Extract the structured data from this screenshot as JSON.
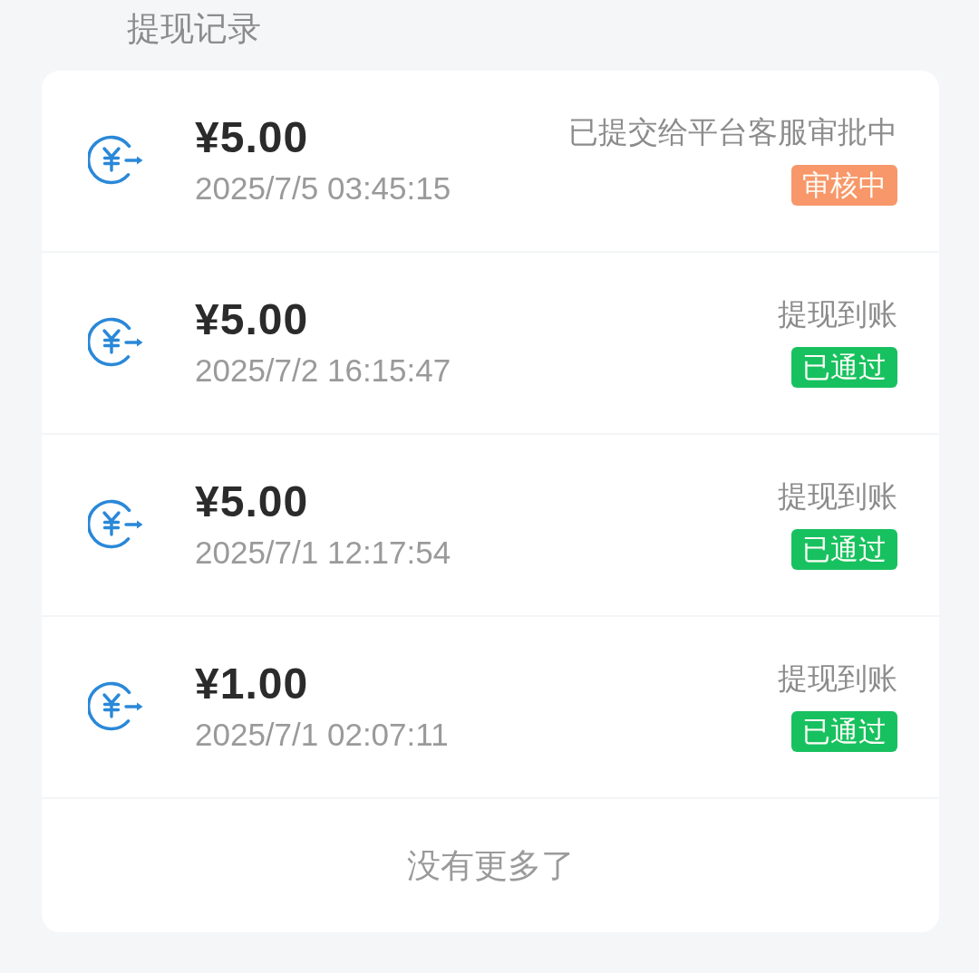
{
  "page": {
    "title": "提现记录"
  },
  "records": [
    {
      "amount": "¥5.00",
      "time": "2025/7/5 03:45:15",
      "note": "已提交给平台客服审批中",
      "badge": {
        "label": "审核中",
        "color": "#f7976a"
      }
    },
    {
      "amount": "¥5.00",
      "time": "2025/7/2 16:15:47",
      "note": "提现到账",
      "badge": {
        "label": "已通过",
        "color": "#18c160"
      }
    },
    {
      "amount": "¥5.00",
      "time": "2025/7/1 12:17:54",
      "note": "提现到账",
      "badge": {
        "label": "已通过",
        "color": "#18c160"
      }
    },
    {
      "amount": "¥1.00",
      "time": "2025/7/1 02:07:11",
      "note": "提现到账",
      "badge": {
        "label": "已通过",
        "color": "#18c160"
      }
    }
  ],
  "footer": {
    "text": "没有更多了"
  }
}
